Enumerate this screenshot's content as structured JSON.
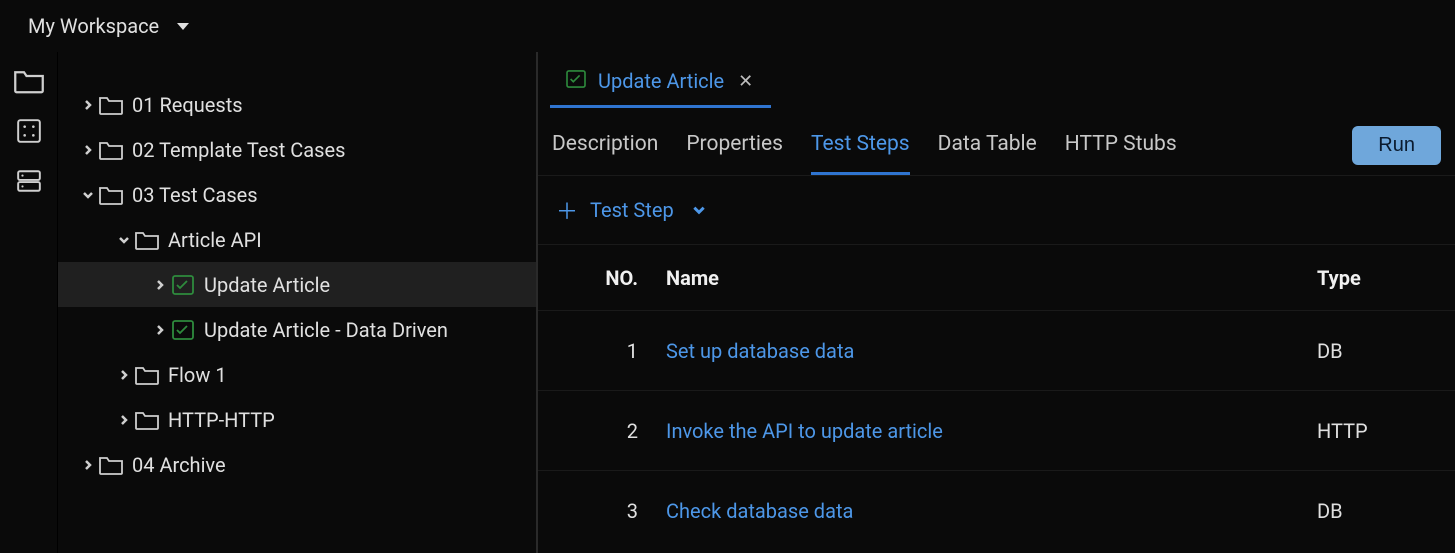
{
  "workspace": {
    "name": "My Workspace"
  },
  "sidebar": {
    "nodes": [
      {
        "label": "01 Requests",
        "kind": "folder",
        "depth": 0,
        "expanded": false,
        "selected": false
      },
      {
        "label": "02 Template Test Cases",
        "kind": "folder",
        "depth": 0,
        "expanded": false,
        "selected": false
      },
      {
        "label": "03 Test Cases",
        "kind": "folder",
        "depth": 0,
        "expanded": true,
        "selected": false
      },
      {
        "label": "Article API",
        "kind": "folder",
        "depth": 1,
        "expanded": true,
        "selected": false
      },
      {
        "label": "Update Article",
        "kind": "test",
        "depth": 2,
        "expanded": false,
        "selected": true
      },
      {
        "label": "Update Article - Data Driven",
        "kind": "test",
        "depth": 2,
        "expanded": false,
        "selected": false
      },
      {
        "label": "Flow 1",
        "kind": "folder",
        "depth": 1,
        "expanded": false,
        "selected": false
      },
      {
        "label": "HTTP-HTTP",
        "kind": "folder",
        "depth": 1,
        "expanded": false,
        "selected": false
      },
      {
        "label": "04 Archive",
        "kind": "folder",
        "depth": 0,
        "expanded": false,
        "selected": false
      }
    ]
  },
  "editor": {
    "tab": {
      "title": "Update Article"
    },
    "subtabs": {
      "items": [
        "Description",
        "Properties",
        "Test Steps",
        "Data Table",
        "HTTP Stubs"
      ],
      "active": 2
    },
    "run_label": "Run",
    "add_step_label": "Test Step",
    "columns": {
      "no": "NO.",
      "name": "Name",
      "type": "Type"
    },
    "steps": [
      {
        "no": "1",
        "name": "Set up database data",
        "type": "DB"
      },
      {
        "no": "2",
        "name": "Invoke the API to update article",
        "type": "HTTP"
      },
      {
        "no": "3",
        "name": "Check database data",
        "type": "DB"
      }
    ]
  }
}
